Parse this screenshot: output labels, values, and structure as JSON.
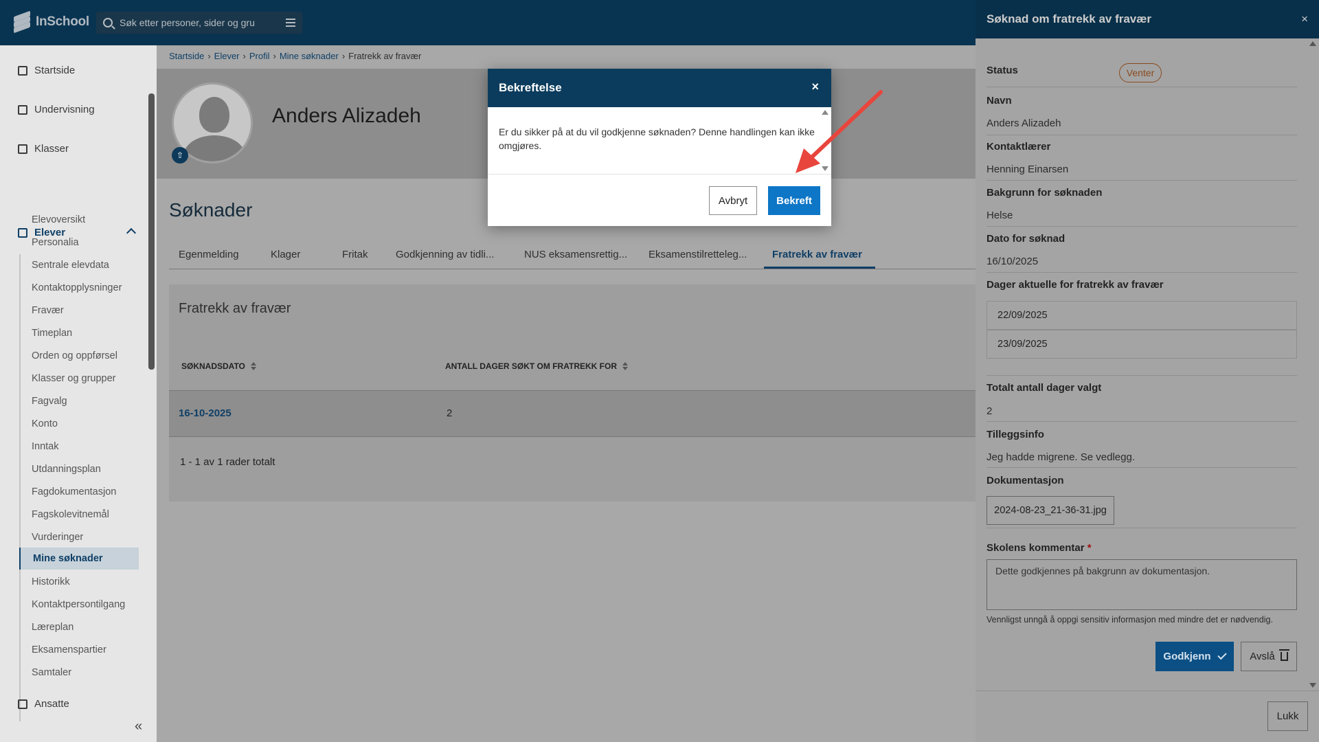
{
  "app": {
    "name": "InSchool"
  },
  "search": {
    "placeholder": "Søk etter personer, sider og gru"
  },
  "sidebar": {
    "top_items": [
      {
        "label": "Startside"
      },
      {
        "label": "Undervisning"
      },
      {
        "label": "Klasser"
      }
    ],
    "group": {
      "label": "Elever"
    },
    "sub_items": [
      {
        "label": "Elevoversikt"
      },
      {
        "label": "Personalia"
      },
      {
        "label": "Sentrale elevdata"
      },
      {
        "label": "Kontaktopplysninger"
      },
      {
        "label": "Fravær"
      },
      {
        "label": "Timeplan"
      },
      {
        "label": "Orden og oppførsel"
      },
      {
        "label": "Klasser og grupper"
      },
      {
        "label": "Fagvalg"
      },
      {
        "label": "Konto"
      },
      {
        "label": "Inntak"
      },
      {
        "label": "Utdanningsplan"
      },
      {
        "label": "Fagdokumentasjon"
      },
      {
        "label": "Fagskolevitnemål"
      },
      {
        "label": "Vurderinger"
      },
      {
        "label": "Mine søknader"
      },
      {
        "label": "Historikk"
      },
      {
        "label": "Kontaktpersontilgang"
      },
      {
        "label": "Læreplan"
      },
      {
        "label": "Eksamenspartier"
      },
      {
        "label": "Samtaler"
      }
    ],
    "bottom_group": {
      "label": "Ansatte"
    },
    "active_item": "Mine søknader"
  },
  "breadcrumb": [
    "Startside",
    "Elever",
    "Profil",
    "Mine søknader",
    "Fratrekk av fravær"
  ],
  "student": {
    "name": "Anders Alizadeh"
  },
  "main": {
    "section_title": "Søknader",
    "tabs": [
      {
        "label": "Egenmelding"
      },
      {
        "label": "Klager"
      },
      {
        "label": "Fritak"
      },
      {
        "label": "Godkjenning av tidli..."
      },
      {
        "label": "NUS eksamensrettig..."
      },
      {
        "label": "Eksamenstilretteleg..."
      },
      {
        "label": "Fratrekk av fravær"
      }
    ],
    "active_tab": "Fratrekk av fravær",
    "card_title": "Fratrekk av fravær",
    "table": {
      "headers": [
        "SØKNADSDATO",
        "ANTALL DAGER SØKT OM FRATREKK FOR"
      ],
      "rows": [
        {
          "date": "16-10-2025",
          "days": "2"
        }
      ]
    },
    "pager_text": "1 - 1 av 1 rader totalt"
  },
  "modal": {
    "title": "Bekreftelse",
    "close": "×",
    "body": "Er du sikker på at du vil godkjenne søknaden? Denne handlingen kan ikke omgjøres.",
    "cancel_label": "Avbryt",
    "confirm_label": "Bekreft"
  },
  "panel": {
    "title": "Søknad om fratrekk av fravær",
    "close": "×",
    "status_label": "Status",
    "status_value": "Venter",
    "name_label": "Navn",
    "name_value": "Anders Alizadeh",
    "teacher_label": "Kontaktlærer",
    "teacher_value": "Henning Einarsen",
    "reason_label": "Bakgrunn for søknaden",
    "reason_value": "Helse",
    "date_label": "Dato for søknad",
    "date_value": "16/10/2025",
    "days_label": "Dager aktuelle for fratrekk av fravær",
    "days": [
      "22/09/2025",
      "23/09/2025"
    ],
    "total_label": "Totalt antall dager valgt",
    "total_value": "2",
    "info_label": "Tilleggsinfo",
    "info_value": "Jeg hadde migrene. Se vedlegg.",
    "doc_label": "Dokumentasjon",
    "doc_file": "2024-08-23_21-36-31.jpg",
    "comment_label": "Skolens kommentar",
    "comment_required": "*",
    "comment_value": "Dette godkjennes på bakgrunn av dokumentasjon.",
    "hint": "Vennligst unngå å oppgi sensitiv informasjon med mindre det er nødvendig.",
    "approve_label": "Godkjenn",
    "reject_label": "Avslå",
    "close_label": "Lukk"
  },
  "colors": {
    "header_bg": "#0b3c5d",
    "primary_button": "#0e76c6",
    "approve_button": "#0b4f85",
    "status_badge": "#8a4a1e",
    "annotation_arrow": "#e8453c"
  }
}
